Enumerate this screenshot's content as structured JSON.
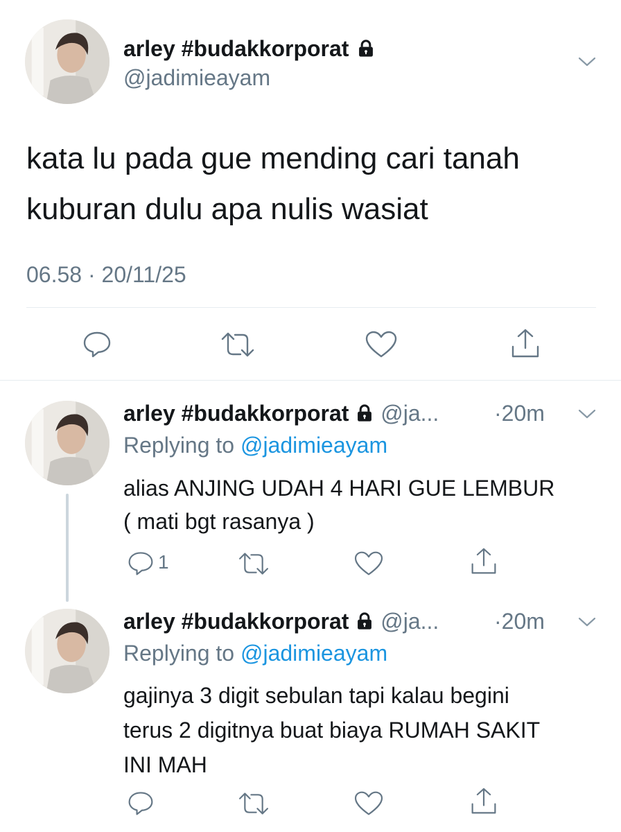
{
  "main_tweet": {
    "display_name": "arley #budakkorporat",
    "handle": "@jadimieayam",
    "text_line1": "kata lu pada gue mending cari tanah",
    "text_line2": "kuburan dulu apa nulis wasiat",
    "timestamp": "06.58 · 20/11/25"
  },
  "replies": [
    {
      "display_name": "arley #budakkorporat",
      "handle_truncated": "@ja...",
      "time": "·20m",
      "replying_prefix": "Replying to",
      "replying_handle": "@jadimieayam",
      "text_lines": [
        "alias ANJING UDAH 4 HARI GUE LEMBUR",
        "( mati bgt rasanya )"
      ],
      "reply_count": "1"
    },
    {
      "display_name": "arley #budakkorporat",
      "handle_truncated": "@ja...",
      "time": "·20m",
      "replying_prefix": "Replying to",
      "replying_handle": "@jadimieayam",
      "text_lines": [
        "gajinya 3 digit sebulan tapi kalau begini",
        "terus 2 digitnya buat biaya RUMAH SAKIT",
        "INI MAH"
      ],
      "reply_count": ""
    }
  ],
  "colors": {
    "text": "#14171a",
    "secondary": "#657786",
    "link": "#1b95e0",
    "thread_line": "#ccd6dd",
    "divider": "#e6ecf0"
  },
  "icons": [
    "lock-icon",
    "chevron-down-icon",
    "reply-icon",
    "retweet-icon",
    "like-icon",
    "share-icon"
  ]
}
